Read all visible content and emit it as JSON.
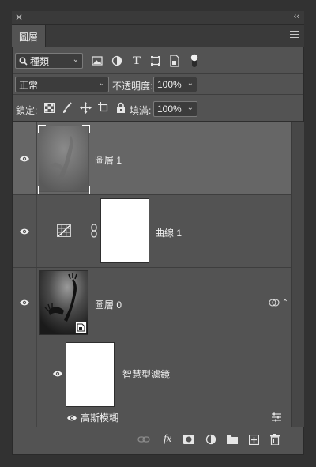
{
  "panel": {
    "close_glyph": "✕",
    "collapse_glyph": "‹‹",
    "tab_label": "圖層"
  },
  "filter": {
    "kind_label": "種類"
  },
  "blend": {
    "mode": "正常",
    "opacity_label": "不透明度:",
    "opacity_value": "100%"
  },
  "lock": {
    "label": "鎖定:",
    "fill_label": "填滿:",
    "fill_value": "100%"
  },
  "layers": [
    {
      "name": "圖層 1",
      "selected": true
    },
    {
      "name": "曲線 1",
      "selected": false
    },
    {
      "name": "圖層 0",
      "selected": false
    }
  ],
  "smart_filters": {
    "label": "智慧型濾鏡",
    "item": "高斯模糊"
  },
  "bottom": {
    "fx": "fx"
  },
  "colors": {
    "panel_bg": "#535353",
    "selected_layer_bg": "#666666",
    "chrome_bg": "#3a3a3a"
  }
}
